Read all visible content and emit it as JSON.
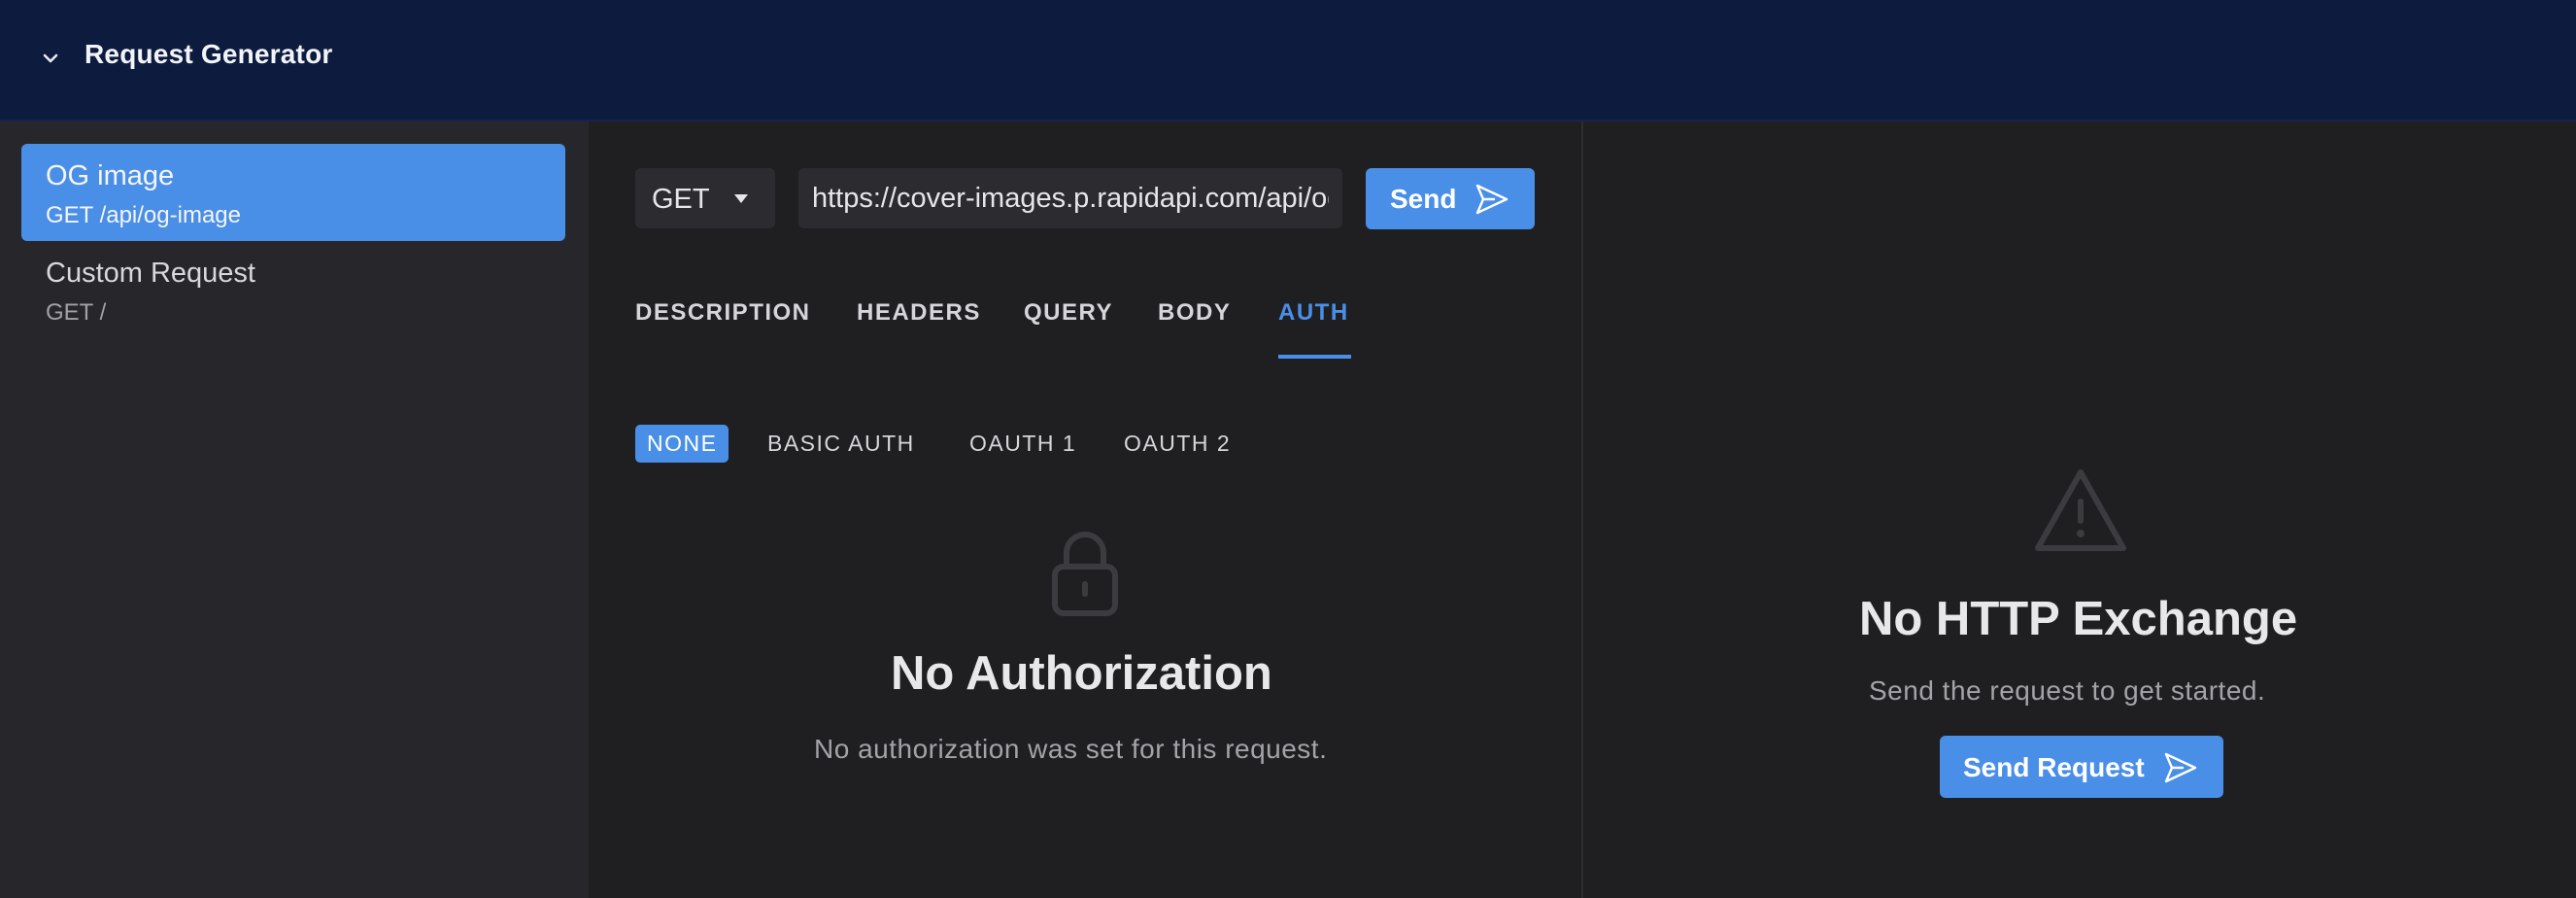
{
  "header": {
    "title": "Request Generator"
  },
  "sidebar": {
    "items": [
      {
        "name": "OG image",
        "path": "GET /api/og-image",
        "active": true
      },
      {
        "name": "Custom Request",
        "path": "GET /",
        "active": false
      }
    ]
  },
  "request": {
    "method": "GET",
    "url": "https://cover-images.p.rapidapi.com/api/og-image",
    "send_label": "Send"
  },
  "tabs": [
    "DESCRIPTION",
    "HEADERS",
    "QUERY",
    "BODY",
    "AUTH"
  ],
  "active_tab": "AUTH",
  "auth": {
    "options": [
      "NONE",
      "BASIC AUTH",
      "OAUTH 1",
      "OAUTH 2"
    ],
    "selected": "NONE",
    "empty_title": "No Authorization",
    "empty_subtitle": "No authorization was set for this request."
  },
  "response": {
    "empty_title": "No HTTP Exchange",
    "empty_subtitle": "Send the request to get started.",
    "send_request_label": "Send Request"
  },
  "colors": {
    "accent": "#4a8fe7",
    "header_bg": "#0d1b3e",
    "sidebar_bg": "#27272b",
    "panel_bg": "#1f1f22"
  },
  "icons": {
    "collapse": "chevron-down-icon",
    "send": "paper-plane-icon",
    "auth_empty": "lock-icon",
    "exchange_empty": "warning-triangle-icon"
  }
}
